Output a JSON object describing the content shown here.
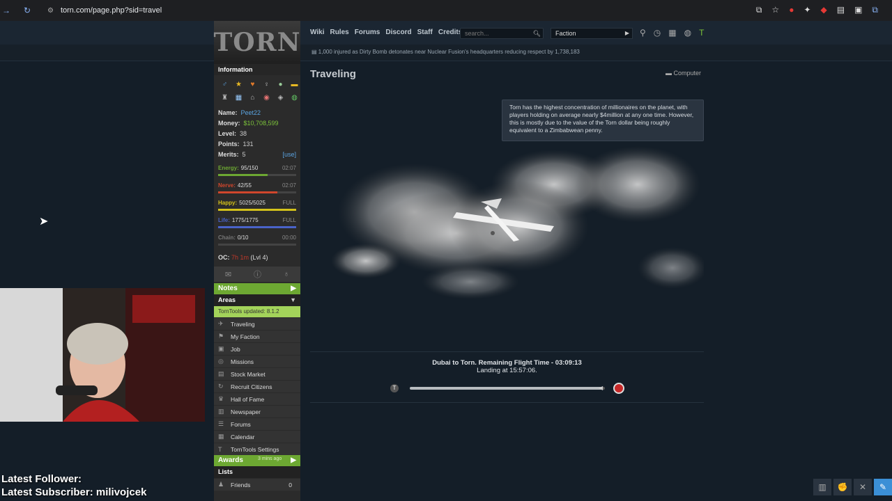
{
  "browser": {
    "url": "torn.com/page.php?sid=travel"
  },
  "logo_text": "TORN",
  "topnav": [
    "Wiki",
    "Rules",
    "Forums",
    "Discord",
    "Staff",
    "Credits"
  ],
  "search_placeholder": "search...",
  "faction_select": "Faction",
  "news_ticker": "1,000 injured as Dirty Bomb detonates near Nuclear Fusion's headquarters reducing respect by 1,738,183",
  "sidebar": {
    "info_header": "Information",
    "name_label": "Name:",
    "name_value": "Peet22",
    "money_label": "Money:",
    "money_value": "$10,708,599",
    "level_label": "Level:",
    "level_value": "38",
    "points_label": "Points:",
    "points_value": "131",
    "merits_label": "Merits:",
    "merits_value": "5",
    "merits_use": "[use]",
    "bars": [
      {
        "label": "Energy:",
        "value": "95/150",
        "timer": "02:07",
        "fill": 0.63,
        "color": "#6da832"
      },
      {
        "label": "Nerve:",
        "value": "42/55",
        "timer": "02:07",
        "fill": 0.76,
        "color": "#d0462c"
      },
      {
        "label": "Happy:",
        "value": "5025/5025",
        "timer": "FULL",
        "fill": 1.0,
        "color": "#d4c21a"
      },
      {
        "label": "Life:",
        "value": "1775/1775",
        "timer": "FULL",
        "fill": 1.0,
        "color": "#4a63c9"
      },
      {
        "label": "Chain:",
        "value": "0/10",
        "timer": "00:00",
        "fill": 0.0,
        "color": "#777777"
      }
    ],
    "oc_label": "OC:",
    "oc_value": "7h 1m",
    "oc_level": "(Lvl 4)",
    "notes_header": "Notes",
    "areas_header": "Areas",
    "torntools_update": "TornTools updated: 8.1.2",
    "areas": [
      {
        "label": "Traveling",
        "icon": "plane-icon"
      },
      {
        "label": "My Faction",
        "icon": "faction-icon"
      },
      {
        "label": "Job",
        "icon": "briefcase-icon"
      },
      {
        "label": "Missions",
        "icon": "missions-icon"
      },
      {
        "label": "Stock Market",
        "icon": "stock-icon"
      },
      {
        "label": "Recruit Citizens",
        "icon": "recruit-icon"
      },
      {
        "label": "Hall of Fame",
        "icon": "trophy-icon"
      },
      {
        "label": "Newspaper",
        "icon": "newspaper-icon"
      },
      {
        "label": "Forums",
        "icon": "forums-icon"
      },
      {
        "label": "Calendar",
        "icon": "calendar-icon"
      },
      {
        "label": "TornTools Settings",
        "icon": "torntools-icon"
      }
    ],
    "awards_header": "Awards",
    "awards_time": "3 mins ago",
    "lists_header": "Lists",
    "friends_label": "Friends",
    "friends_count": "0"
  },
  "main": {
    "title": "Traveling",
    "computer_label": "Computer",
    "tooltip": "Torn has the highest concentration of millionaires on the planet, with players holding on average nearly $4million at any one time. However, this is mostly due to the value of the Torn dollar being roughly equivalent to a Zimbabwean penny.",
    "flight_status": "Dubai to Torn. Remaining Flight Time - 03:09:13",
    "landing": "Landing at 15:57:06.",
    "progress_fraction": 0.98
  },
  "stream_overlay": {
    "follower_label": "Latest Follower:",
    "subscriber_label": "Latest Subscriber: milivojcek"
  }
}
